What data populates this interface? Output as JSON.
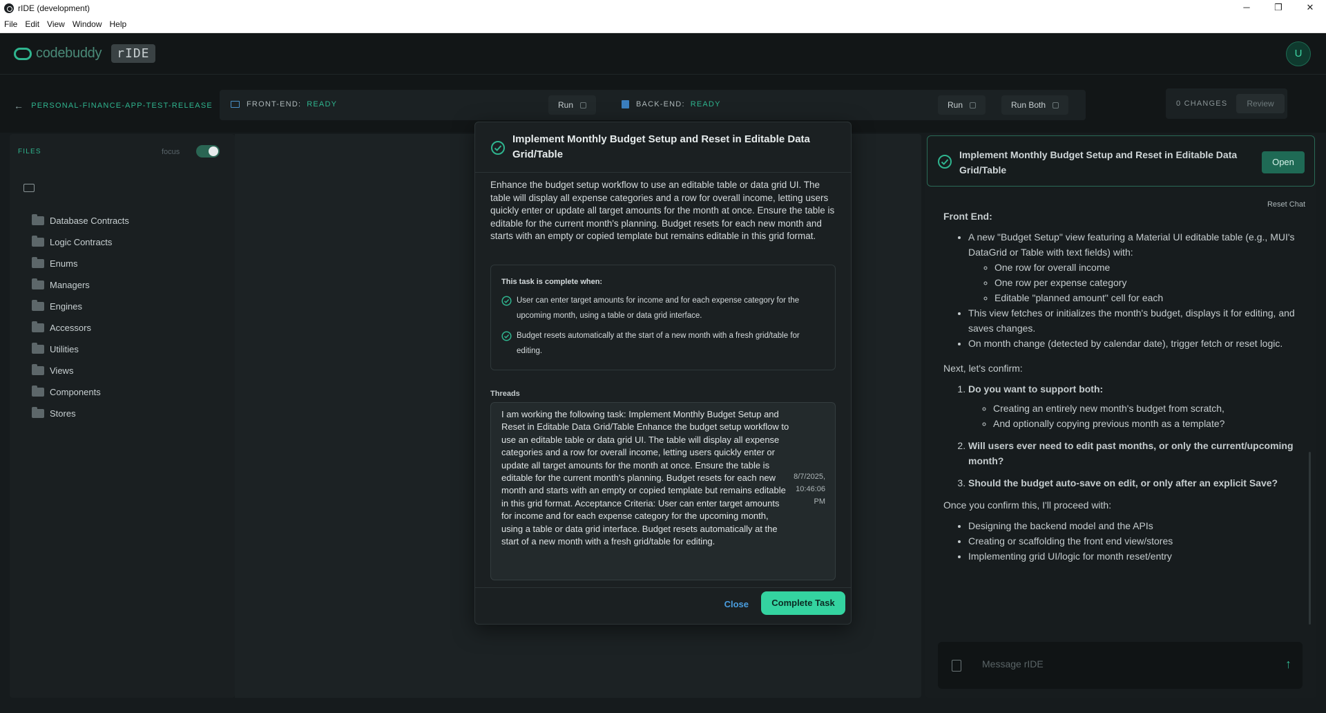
{
  "window": {
    "title": "rIDE (development)",
    "minimize": "─",
    "maximize": "❐",
    "close": "✕"
  },
  "menu": [
    "File",
    "Edit",
    "View",
    "Window",
    "Help"
  ],
  "header": {
    "logo_text": "codebuddy",
    "badge": "rIDE",
    "avatar_initial": "U"
  },
  "toolbar": {
    "project": "PERSONAL-FINANCE-APP-TEST-RELEASE",
    "frontend_label": "FRONT-END:",
    "frontend_status": "READY",
    "backend_label": "BACK-END:",
    "backend_status": "READY",
    "run_label": "Run",
    "run_both_label": "Run Both",
    "changes": "0 CHANGES",
    "review_label": "Review"
  },
  "files": {
    "header": "FILES",
    "focus_label": "focus",
    "folders": [
      "Database Contracts",
      "Logic Contracts",
      "Enums",
      "Managers",
      "Engines",
      "Accessors",
      "Utilities",
      "Views",
      "Components",
      "Stores"
    ]
  },
  "chat": {
    "task_title": "Implement Monthly Budget Setup and Reset in Editable Data Grid/Table",
    "open_label": "Open",
    "reset_label": "Reset Chat",
    "section_heading": "Front End:",
    "bullets": [
      "A new \"Budget Setup\" view featuring a Material UI editable table (e.g., MUI's DataGrid or Table with text fields) with:",
      "This view fetches or initializes the month's budget, displays it for editing, and saves changes.",
      "On month change (detected by calendar date), trigger fetch or reset logic."
    ],
    "sub_bullets": [
      "One row for overall income",
      "One row per expense category",
      "Editable \"planned amount\" cell for each"
    ],
    "confirm_intro": "Next, let's confirm:",
    "questions": [
      "Do you want to support both:",
      "Will users ever need to edit past months, or only the current/upcoming month?",
      "Should the budget auto-save on edit, or only after an explicit Save?"
    ],
    "q1_options": [
      "Creating an entirely new month's budget from scratch,",
      "And optionally copying previous month as a template?"
    ],
    "proceed_intro": "Once you confirm this, I'll proceed with:",
    "proceed_items": [
      "Designing the backend model and the APIs",
      "Creating or scaffolding the front end view/stores",
      "Implementing grid UI/logic for month reset/entry"
    ],
    "placeholder": "Message rIDE"
  },
  "modal": {
    "title": "Implement Monthly Budget Setup and Reset in Editable Data Grid/Table",
    "description": "Enhance the budget setup workflow to use an editable table or data grid UI. The table will display all expense categories and a row for overall income, letting users quickly enter or update all target amounts for the month at once. Ensure the table is editable for the current month's planning. Budget resets for each new month and starts with an empty or copied template but remains editable in this grid format.",
    "criteria_title": "This task is complete when:",
    "criteria": [
      "User can enter target amounts for income and for each expense category for the upcoming month, using a table or data grid interface.",
      "Budget resets automatically at the start of a new month with a fresh grid/table for editing."
    ],
    "threads_label": "Threads",
    "thread_text": "I am working the following task: Implement Monthly Budget Setup and Reset in Editable Data Grid/Table Enhance the budget setup workflow to use an editable table or data grid UI. The table will display all expense categories and a row for overall income, letting users quickly enter or update all target amounts for the month at once. Ensure the table is editable for the current month's planning. Budget resets for each new month and starts with an empty or copied template but remains editable in this grid format. Acceptance Criteria: User can enter target amounts for income and for each expense category for the upcoming month, using a table or data grid interface. Budget resets automatically at the start of a new month with a fresh grid/table for editing.",
    "thread_date": "8/7/2025,",
    "thread_time": "10:46:06",
    "thread_ampm": "PM",
    "close_label": "Close",
    "complete_label": "Complete Task"
  },
  "colors": {
    "accent": "#2fb58f",
    "link": "#4a9ee0",
    "complete": "#34d3a0"
  }
}
